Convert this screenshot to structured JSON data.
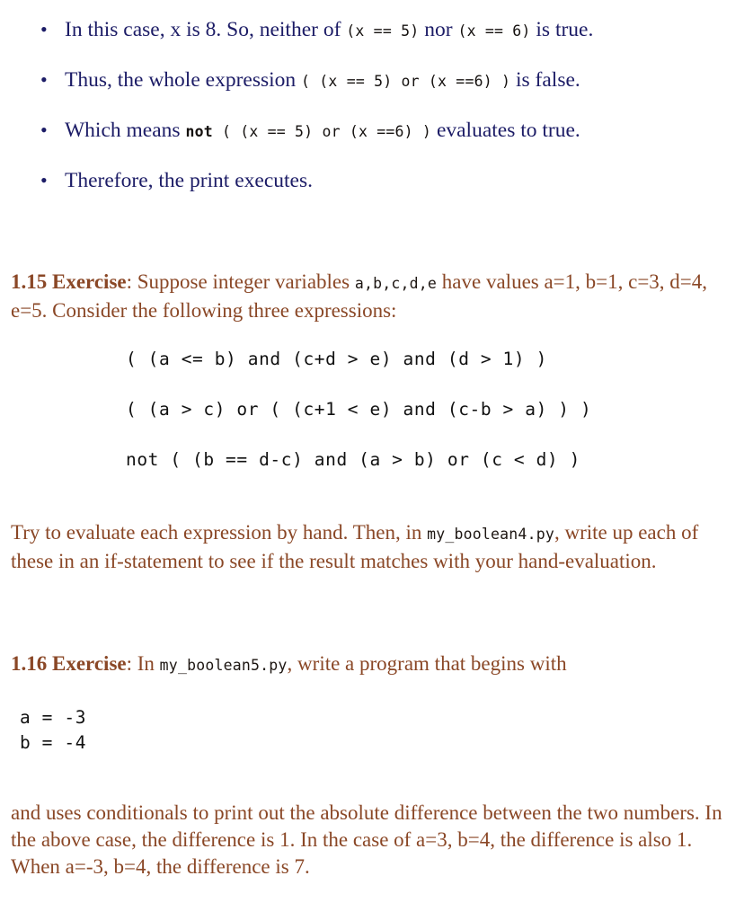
{
  "colors": {
    "navy": "#1c1c66",
    "brown": "#8a4726",
    "code": "#111111",
    "background": "#ffffff"
  },
  "bullets": [
    {
      "marker": "•",
      "parts": [
        {
          "type": "serif",
          "text": "In this case, x is 8. So, neither of "
        },
        {
          "type": "mono",
          "text": "(x == 5)"
        },
        {
          "type": "serif",
          "text": " nor "
        },
        {
          "type": "mono",
          "text": "(x == 6)"
        },
        {
          "type": "serif",
          "text": " is true."
        }
      ]
    },
    {
      "marker": "•",
      "parts": [
        {
          "type": "serif",
          "text": "Thus, the whole expression "
        },
        {
          "type": "mono",
          "text": "( (x == 5) or (x ==6) )"
        },
        {
          "type": "serif",
          "text": " is false."
        }
      ]
    },
    {
      "marker": "•",
      "parts": [
        {
          "type": "serif",
          "text": "Which means "
        },
        {
          "type": "mono-bold",
          "text": "not"
        },
        {
          "type": "mono",
          "text": " ( (x == 5) or (x ==6) )"
        },
        {
          "type": "serif",
          "text": " evaluates to true."
        }
      ]
    },
    {
      "marker": "•",
      "parts": [
        {
          "type": "serif",
          "text": "Therefore, the print executes."
        }
      ]
    }
  ],
  "exercise_115": {
    "label": "1.15 Exercise",
    "text_before": ": Suppose integer variables ",
    "mono_vars": "a,b,c,d,e",
    "text_after": " have values a=1, b=1, c=3, d=4, e=5. Consider the following three expressions:",
    "expressions": [
      "( (a <= b) and (c+d > e) and (d > 1) )",
      "( (a > c) or ( (c+1 < e) and (c-b > a) ) )",
      "not ( (b == d-c) and (a > b) or (c < d) )"
    ],
    "followup_before": "Try to evaluate each expression by hand. Then, in ",
    "followup_mono": "my_boolean4.py",
    "followup_after": ", write up each of these in an if-statement to see if the result matches with your hand-evaluation."
  },
  "exercise_116": {
    "label": "1.16 Exercise",
    "text_before": ": In ",
    "mono_file": "my_boolean5.py",
    "text_after": ", write a program that begins with",
    "code_lines": [
      "a = -3",
      "b = -4"
    ],
    "closing_text": "and uses conditionals to print out the absolute difference between the two numbers. In the above case, the difference is 1. In the case of a=3, b=4, the difference is also 1. When a=-3, b=4, the difference is 7."
  }
}
